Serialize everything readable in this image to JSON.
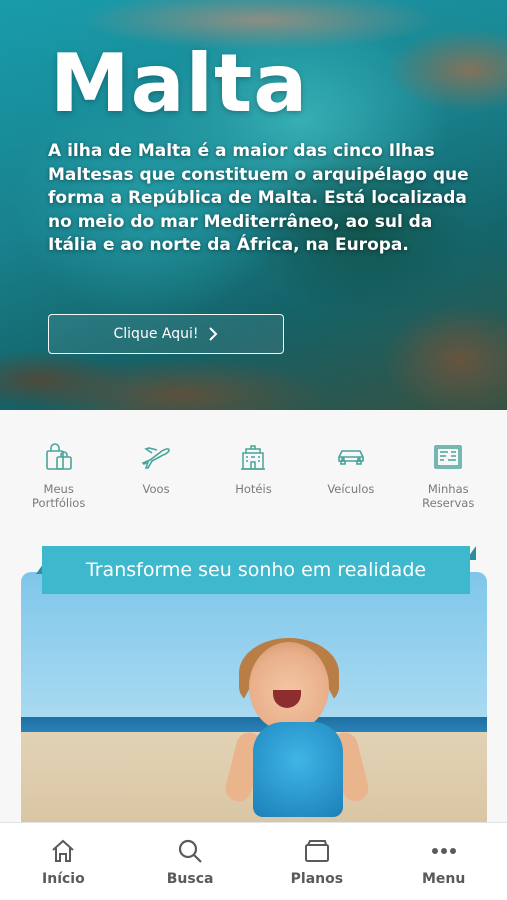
{
  "hero": {
    "title": "Malta",
    "description": "A ilha de Malta é a maior das cinco Ilhas Maltesas que constituem o arquipélago que forma a República de Malta. Está localizada no meio do mar Mediterrâneo, ao sul da Itália e ao norte da África, na Europa.",
    "button_label": "Clique Aqui!"
  },
  "quick_nav": [
    {
      "label": "Meus\nPortfólios",
      "icon": "shopping-bags-icon"
    },
    {
      "label": "Voos",
      "icon": "airplane-icon"
    },
    {
      "label": "Hotéis",
      "icon": "hotel-icon"
    },
    {
      "label": "Veículos",
      "icon": "car-icon"
    },
    {
      "label": "Minhas\nReservas",
      "icon": "reservations-icon"
    }
  ],
  "promo": {
    "title": "Transforme seu sonho em realidade"
  },
  "bottom_nav": [
    {
      "label": "Início",
      "icon": "home-icon"
    },
    {
      "label": "Busca",
      "icon": "search-icon"
    },
    {
      "label": "Planos",
      "icon": "wallet-icon"
    },
    {
      "label": "Menu",
      "icon": "more-dots-icon"
    }
  ],
  "colors": {
    "accent": "#3eb8cc",
    "icon_teal": "#4aa39a",
    "nav_text": "#5a5a5a"
  }
}
